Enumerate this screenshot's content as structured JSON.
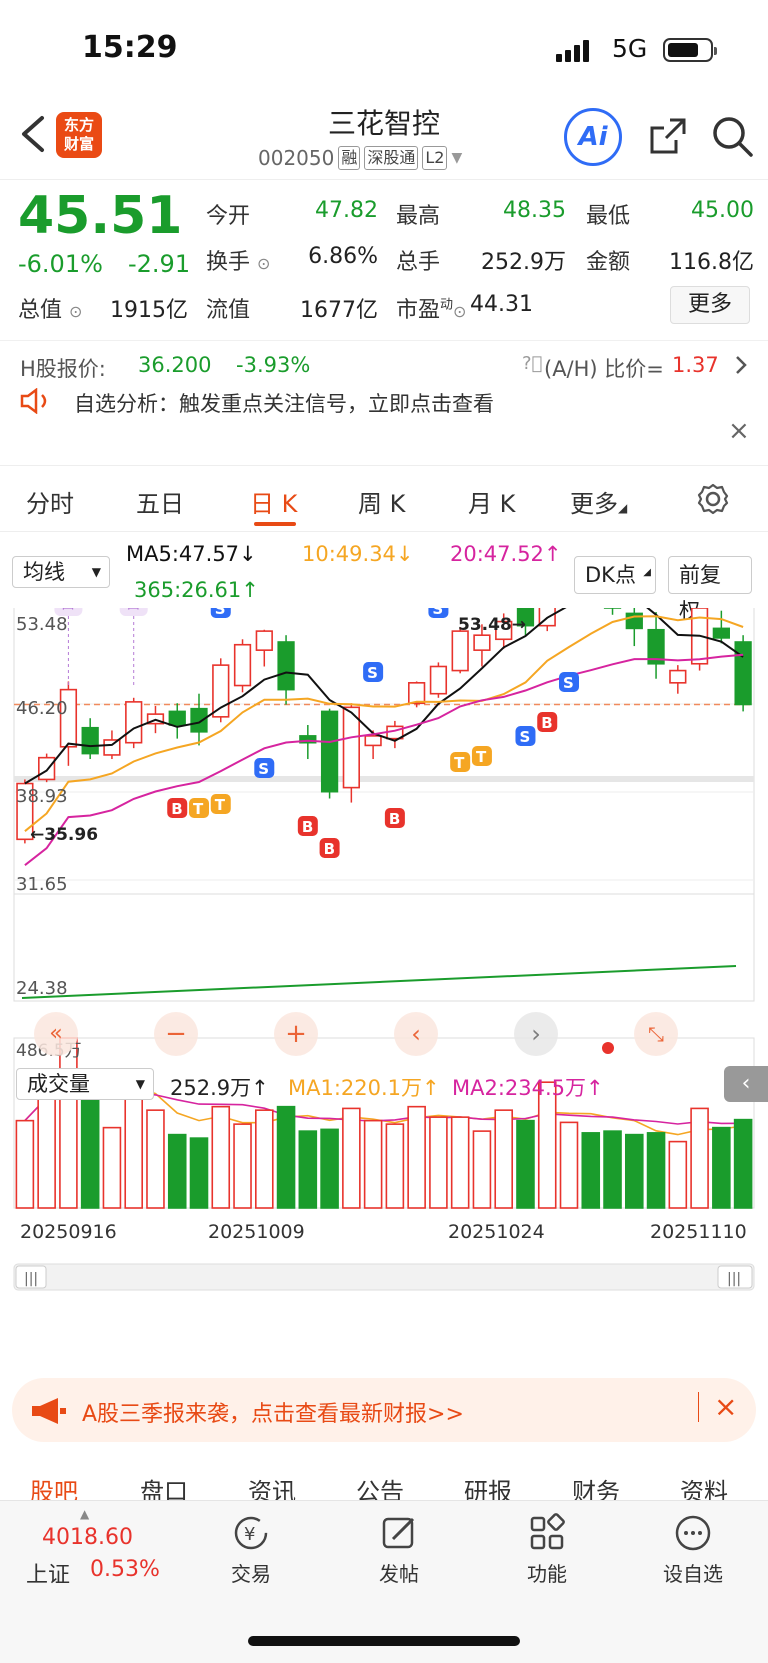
{
  "status": {
    "time": "15:29",
    "network": "5G"
  },
  "header": {
    "title": "三花智控",
    "code": "002050",
    "tags": [
      "融",
      "深股通",
      "L2"
    ],
    "logo": [
      "东方",
      "财富"
    ],
    "ai": "Ai"
  },
  "quote": {
    "price": "45.51",
    "pct": "-6.01%",
    "change": "-2.91",
    "open_label": "今开",
    "open": "47.82",
    "high_label": "最高",
    "high": "48.35",
    "low_label": "最低",
    "low": "45.00",
    "turnover_label": "换手",
    "turnover": "6.86%",
    "volume_label": "总手",
    "volume": "252.9万",
    "amount_label": "金额",
    "amount": "116.8亿",
    "mktcap_label": "总值",
    "mktcap": "1915亿",
    "float_label": "流值",
    "float": "1677亿",
    "pe_label": "市盈",
    "pe_sup": "动",
    "pe": "44.31",
    "more": "更多"
  },
  "hshare": {
    "label": "H股报价:",
    "price": "36.200",
    "pct": "-3.93%",
    "ah_label": "(A/H) 比价=",
    "ah": "1.37"
  },
  "notice": {
    "text": "自选分析：触发重点关注信号，立即点击查看"
  },
  "tabs": [
    "分时",
    "五日",
    "日 K",
    "周 K",
    "月 K",
    "更多"
  ],
  "active_tab": "日 K",
  "ma": {
    "select": "均线",
    "ma5": "MA5:47.57↓",
    "ma10": "10:49.34↓",
    "ma20": "20:47.52↑",
    "ma365": "365:26.61↑",
    "dk": "DK点",
    "adjust": "前复权"
  },
  "chart_labels": {
    "y_top": "53.48",
    "y_2": "46.20",
    "y_3": "38.93",
    "y_4": "31.65",
    "y_5": "24.38",
    "max_ann": "53.48→",
    "min_ann": "←35.96"
  },
  "volume": {
    "select": "成交量",
    "vol": "252.9万↑",
    "ma1": "MA1:220.1万↑",
    "ma2": "MA2:234.5万↑",
    "max": "486.5万"
  },
  "dates": [
    "20250916",
    "20251009",
    "20251024",
    "20251110"
  ],
  "promo": {
    "text": "A股三季报来袭，点击查看最新财报>>"
  },
  "footer_tabs": [
    "股吧",
    "盘口",
    "资讯",
    "公告",
    "研报",
    "财务",
    "资料"
  ],
  "bottom": {
    "index_val": "4018.60",
    "index_name": "上证",
    "index_pct": "0.53%",
    "items": [
      "交易",
      "发帖",
      "功能",
      "设自选"
    ]
  },
  "colors": {
    "up": "#e8332c",
    "down": "#1a9c2c",
    "accent": "#e84a15",
    "ma5": "#111111",
    "ma10": "#f5a623",
    "ma20": "#d6249f",
    "ma365": "#1a9c2c"
  },
  "chart_data": {
    "type": "candlestick",
    "ylim": [
      24.38,
      53.48
    ],
    "ohlc": [
      [
        35.6,
        40.0,
        35.3,
        39.7
      ],
      [
        40.0,
        41.9,
        39.8,
        41.6
      ],
      [
        42.4,
        47.2,
        41.0,
        46.6
      ],
      [
        43.8,
        44.5,
        41.5,
        41.9
      ],
      [
        41.8,
        43.6,
        41.5,
        42.9
      ],
      [
        42.7,
        46.0,
        42.3,
        45.7
      ],
      [
        44.1,
        45.4,
        43.4,
        44.8
      ],
      [
        45.0,
        45.6,
        43.0,
        44.0
      ],
      [
        45.2,
        46.3,
        42.5,
        43.5
      ],
      [
        44.6,
        48.9,
        44.2,
        48.4
      ],
      [
        46.9,
        50.3,
        46.4,
        49.9
      ],
      [
        49.5,
        51.0,
        48.3,
        50.9
      ],
      [
        50.1,
        50.6,
        45.5,
        46.6
      ],
      [
        43.2,
        44.0,
        41.5,
        42.7
      ],
      [
        45.0,
        45.2,
        38.6,
        39.1
      ],
      [
        39.4,
        45.6,
        38.3,
        45.3
      ],
      [
        42.5,
        43.6,
        41.5,
        43.2
      ],
      [
        43.0,
        44.3,
        42.3,
        43.9
      ],
      [
        45.6,
        47.2,
        45.3,
        47.1
      ],
      [
        46.3,
        48.6,
        46.0,
        48.3
      ],
      [
        48.0,
        51.2,
        47.8,
        50.9
      ],
      [
        49.5,
        51.4,
        48.3,
        50.6
      ],
      [
        50.3,
        52.2,
        49.6,
        51.6
      ],
      [
        52.8,
        53.2,
        50.6,
        51.3
      ],
      [
        51.3,
        55.7,
        50.9,
        55.0
      ],
      [
        54.9,
        55.6,
        53.5,
        55.4
      ],
      [
        55.4,
        55.8,
        52.8,
        52.9
      ],
      [
        53.9,
        54.8,
        52.1,
        52.6
      ],
      [
        52.2,
        52.6,
        49.8,
        51.1
      ],
      [
        51.0,
        52.3,
        47.4,
        48.5
      ],
      [
        47.1,
        48.4,
        46.3,
        48.0
      ],
      [
        48.5,
        52.9,
        48.0,
        52.6
      ],
      [
        51.1,
        52.4,
        50.0,
        50.4
      ],
      [
        50.1,
        50.6,
        45.0,
        45.51
      ]
    ],
    "volume": [
      250,
      380,
      486.5,
      310,
      230,
      330,
      280,
      210,
      200,
      290,
      240,
      280,
      290,
      220,
      225,
      285,
      250,
      240,
      290,
      260,
      260,
      220,
      280,
      250,
      360,
      245,
      215,
      220,
      210,
      215,
      190,
      285,
      230,
      252.9
    ],
    "vol_ylim": [
      0,
      486.5
    ]
  }
}
